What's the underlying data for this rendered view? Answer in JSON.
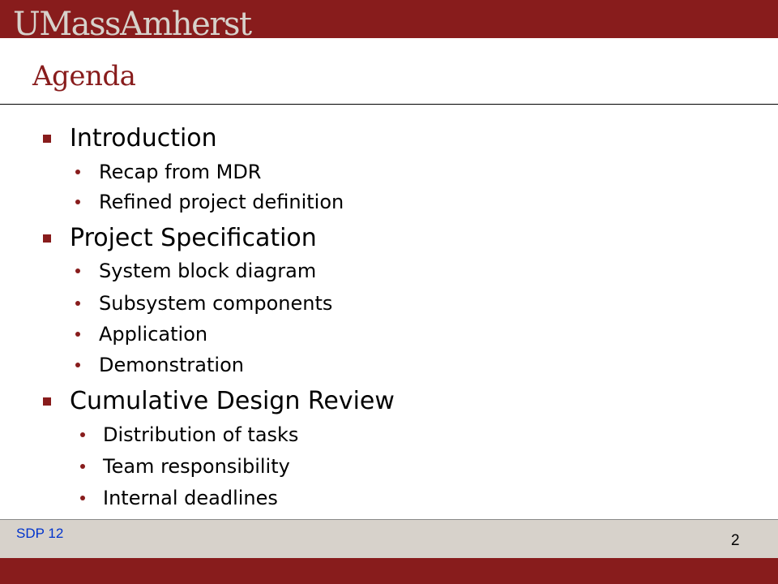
{
  "header": {
    "logo_text": "UMassAmherst"
  },
  "slide": {
    "title": "Agenda",
    "sections": [
      {
        "label": "Introduction",
        "items": [
          "Recap from MDR",
          "Refined project definition"
        ]
      },
      {
        "label": "Project Specification",
        "items": [
          "System block diagram",
          "Subsystem components",
          "Application",
          "Demonstration"
        ]
      },
      {
        "label": "Cumulative Design Review",
        "items": [
          "Distribution of tasks",
          "Team responsibility",
          "Internal deadlines"
        ]
      }
    ]
  },
  "footer": {
    "label": "SDP 12",
    "page_number": "2"
  },
  "colors": {
    "maroon": "#881c1c",
    "sand": "#d7d2cb",
    "footer_text": "#0033cc"
  }
}
